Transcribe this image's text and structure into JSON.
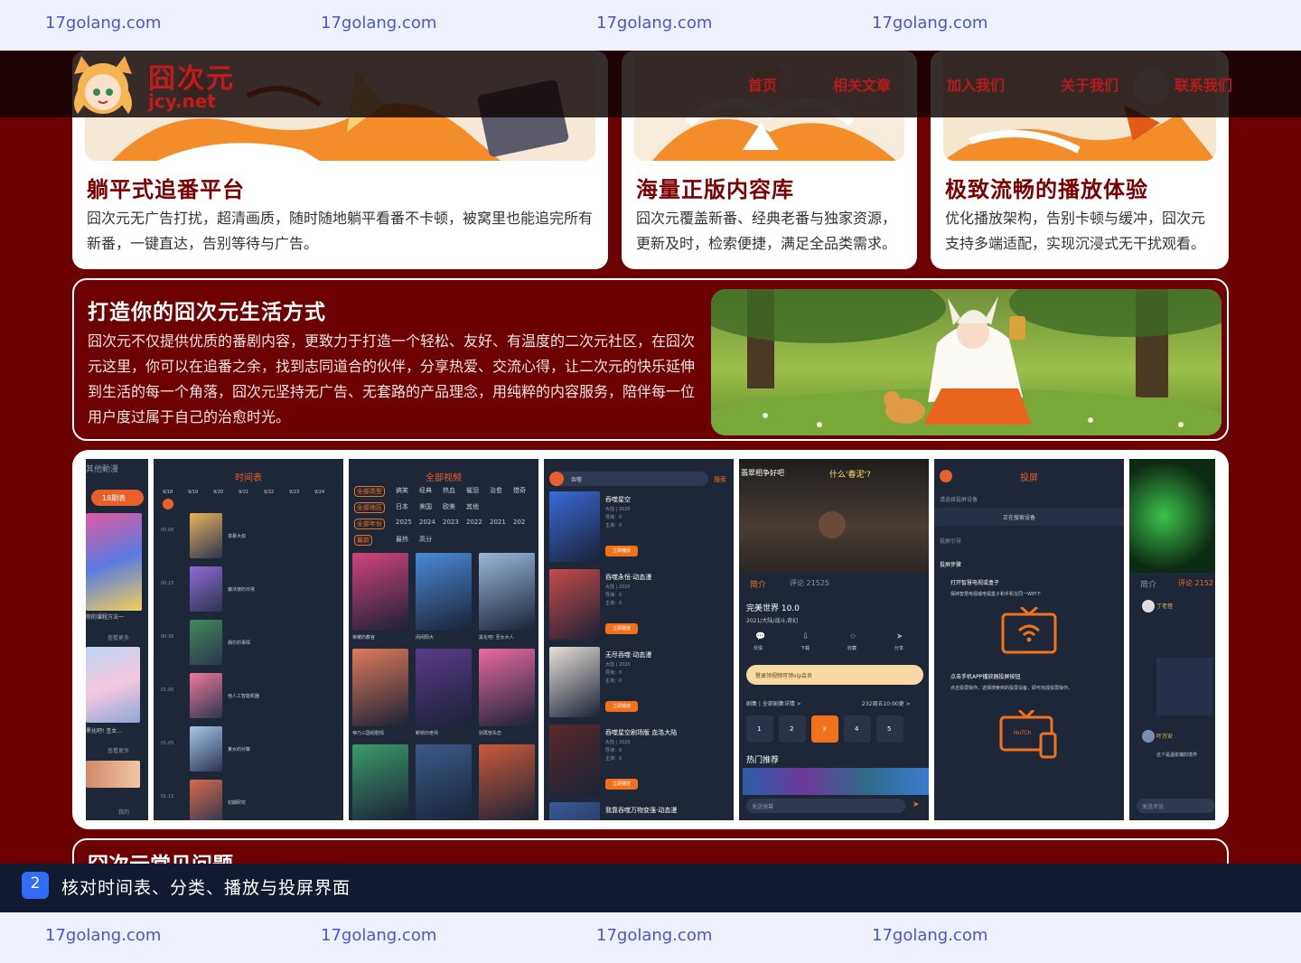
{
  "watermark": {
    "text": "17golang.com"
  },
  "nav": {
    "logo_title": "囧次元",
    "logo_domain": "jcy.net",
    "links": [
      "首页",
      "相关文章",
      "加入我们",
      "关于我们",
      "联系我们"
    ]
  },
  "features": [
    {
      "title": "躺平式追番平台",
      "text": "囧次元无广告打扰，超清画质，随时随地躺平看番不卡顿，被窝里也能追完所有新番，一键直达，告别等待与广告。"
    },
    {
      "title": "海量正版内容库",
      "text": "囧次元覆盖新番、经典老番与独家资源，更新及时，检索便捷，满足全品类需求。"
    },
    {
      "title": "极致流畅的播放体验",
      "text": "优化播放架构，告别卡顿与缓冲，囧次元支持多端适配，实现沉浸式无干扰观看。"
    }
  ],
  "lifestyle": {
    "title": "打造你的囧次元生活方式",
    "text": "囧次元不仅提供优质的番剧内容，更致力于打造一个轻松、友好、有温度的二次元社区，在囧次元这里，你可以在追番之余，找到志同道合的伙伴，分享热爱、交流心得，让二次元的快乐延伸到生活的每一个角落，囧次元坚持无广告、无套路的产品理念，用纯粹的内容服务，陪伴每一位用户度过属于自己的治愈时光。"
  },
  "screens": {
    "s1": {
      "tabs": "其他動漫",
      "badge": "18期表",
      "more": "查看更多",
      "label1": "你的课程方法一",
      "label2": "黑化吧! 圣女...",
      "tab_mine": "我的"
    },
    "s2": {
      "title": "时间表",
      "days": [
        "9/18",
        "9/19",
        "9/20",
        "9/21",
        "9/22",
        "9/23",
        "9/24"
      ],
      "times": [
        "00:00",
        "00:15",
        "00:30",
        "01:00",
        "01:05",
        "01:15"
      ],
      "items": [
        "羡慕大叔",
        "魔法使的日常",
        "偶尔的事情",
        "他人工智能机器",
        "某女的对策",
        "初期研究"
      ]
    },
    "s3": {
      "title": "全部视频",
      "row1_label": "全部类型",
      "row1": [
        "搞笑",
        "经典",
        "热血",
        "催泪",
        "治愈",
        "猎奇"
      ],
      "row2_label": "全部地区",
      "row2": [
        "日本",
        "美国",
        "欧美",
        "其他"
      ],
      "row3_label": "全部年份",
      "row3": [
        "2025",
        "2024",
        "2023",
        "2022",
        "2021",
        "202"
      ],
      "row4_label": "最新",
      "row4": [
        "最热",
        "高分"
      ],
      "captions": [
        "荣耀的教官",
        "闲闲阳大",
        "黑化吧! 圣女大人",
        "帝乃三国组剧情",
        "断桥旧老师",
        "别再管失恋"
      ]
    },
    "s4": {
      "search_text": "吞噬",
      "search_btn": "搜索",
      "results": [
        "吞噬星空",
        "吞噬永恒·动态漫",
        "无尽吞噬·动态漫",
        "吞噬星空剧场版 血洛大陆",
        "我靠吞噬万物变强·动态漫"
      ],
      "play": "立即播放",
      "meta": [
        "大陆 | 2020",
        "导演：0",
        "主演：0"
      ]
    },
    "s5": {
      "top_text": "翡翠相争好吧",
      "center_text": "什么'春泥'?",
      "tab_intro": "简介",
      "tab_comment": "评论 21525",
      "title": "完美世界 10.0",
      "meta": "2021/大陆/战斗,奇幻",
      "actions": [
        "反馈",
        "下载",
        "收藏",
        "分享"
      ],
      "vip": "登录领视频可领vip会员",
      "episode_label": "剧集 | 全部剧集详情 >",
      "episode_note": "232周五10:00更 >",
      "episodes": [
        "1",
        "2",
        "3",
        "4",
        "5"
      ],
      "hot": "热门推荐",
      "danmaku": "发送弹幕"
    },
    "s6": {
      "title": "投屏",
      "choose": "请选择投屏设备",
      "searching": "正在搜索设备",
      "guide": "投屏引导",
      "steps": "投屏步骤",
      "step1": "打开智慧电视或盒子",
      "step1_note": "保持智慧电视或电视盒子和手机在同一WiFi下",
      "step2": "点击手机APP播放器投屏按钮",
      "step2_note": "点击投屏操作，选择搜索到的投屏设备，即可完成投屏操作。",
      "tv_label": "HoTCh"
    },
    "s7": {
      "tab_intro": "简介",
      "tab_comment": "评论 2152",
      "user1": "丁老怪",
      "user2": "叶万安",
      "comment_note": "这个是温泉镇的境界",
      "send": "发送评论"
    }
  },
  "faq": {
    "title": "囧次元常见问题"
  },
  "caption": {
    "num": "2",
    "text": "核对时间表、分类、播放与投屏界面"
  },
  "colors": {
    "brand": "#7a0000",
    "background": "#6d0000",
    "accent": "#f2711c",
    "nav_link": "#b81b1b",
    "caption_badge": "#2f6df6"
  }
}
